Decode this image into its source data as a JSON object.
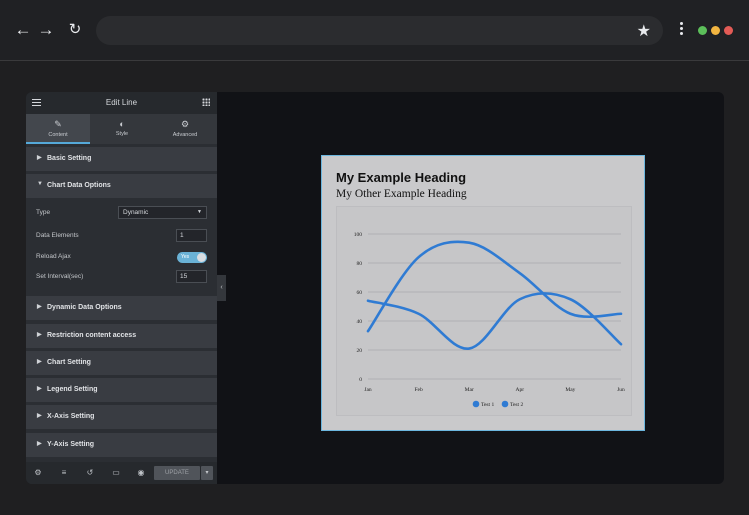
{
  "panel": {
    "title": "Edit Line",
    "tabs": [
      {
        "label": "Content",
        "icon": "pencil-icon"
      },
      {
        "label": "Style",
        "icon": "contrast-icon"
      },
      {
        "label": "Advanced",
        "icon": "gear-icon"
      }
    ],
    "sections": [
      "Basic Setting",
      "Chart Data Options",
      "Dynamic Data Options",
      "Restriction content access",
      "Chart Setting",
      "Legend Setting",
      "X-Axis Setting",
      "Y-Axis Setting"
    ],
    "fields": {
      "type_label": "Type",
      "type_value": "Dynamic",
      "data_elements_label": "Data Elements",
      "data_elements_value": "1",
      "reload_ajax_label": "Reload Ajax",
      "reload_ajax_state": "Yes",
      "interval_label": "Set Interval(sec)",
      "interval_value": "15"
    },
    "footer": {
      "update_label": "UPDATE"
    }
  },
  "card": {
    "heading": "My Example Heading",
    "subheading": "My Other Example Heading"
  },
  "colors": {
    "accent": "#55a9d9",
    "line": "#2f7bd3"
  },
  "chart_data": {
    "type": "line",
    "categories": [
      "Jan",
      "Feb",
      "Mar",
      "Apr",
      "May",
      "Jun"
    ],
    "series": [
      {
        "name": "Test 1",
        "values": [
          33,
          84,
          94,
          73,
          45,
          45
        ]
      },
      {
        "name": "Test 2",
        "values": [
          54,
          45,
          21,
          55,
          55,
          24
        ]
      }
    ],
    "yticks": [
      "0",
      "20",
      "40",
      "60",
      "80",
      "100"
    ],
    "ylim": [
      0,
      100
    ],
    "grid": true,
    "legend": "bottom"
  }
}
